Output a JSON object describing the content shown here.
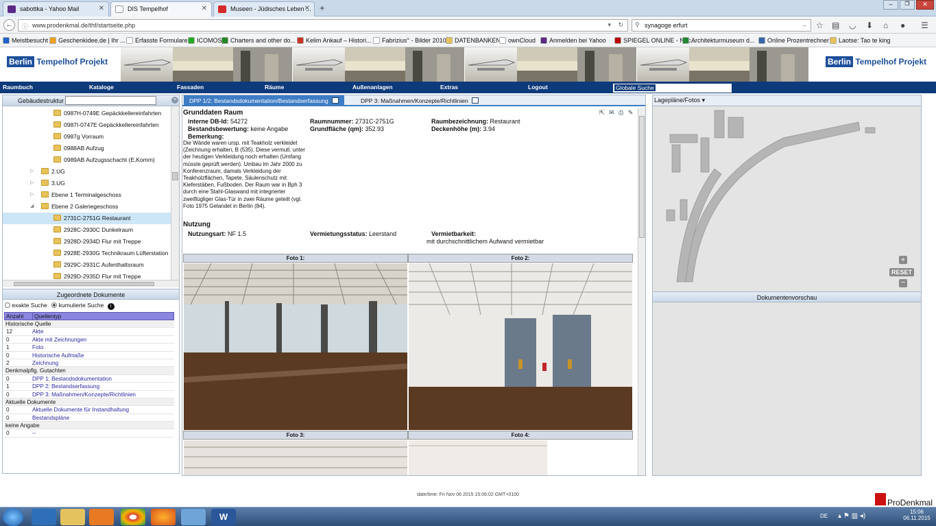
{
  "browser": {
    "tabs": [
      {
        "label": "sabottka - Yahoo Mail",
        "color": "#5b2a86"
      },
      {
        "label": "DIS Tempelhof",
        "color": "#ffffff"
      },
      {
        "label": "Museen - Jüdisches Leben ...",
        "color": "#d6292a"
      }
    ],
    "new_tab": "+",
    "url": "www.prodenkmal.de/thf/startseite.php",
    "search_value": "synagoge erfurt"
  },
  "bookmarks": [
    {
      "label": "Meistbesucht",
      "color": "#1d64c8"
    },
    {
      "label": "Geschenkidee.de | Ihr ...",
      "color": "#f0a21a"
    },
    {
      "label": "Erfasste Formulare",
      "color": "#ffffff"
    },
    {
      "label": "ICOMOS",
      "color": "#22aa22"
    },
    {
      "label": "Charters and other do...",
      "color": "#228822"
    },
    {
      "label": "Kelim Ankauf – Histori...",
      "color": "#cc3322"
    },
    {
      "label": "Fabrizius° - Bilder 2010",
      "color": "#ffffff"
    },
    {
      "label": "DATENBANKEN",
      "color": "#e8c25a"
    },
    {
      "label": "ownCloud",
      "color": "#ffffff"
    },
    {
      "label": "Anmelden bei Yahoo",
      "color": "#5b2a86"
    },
    {
      "label": "SPIEGEL ONLINE - Nac...",
      "color": "#b80000"
    },
    {
      "label": "Architekturmuseum d...",
      "color": "#228833"
    },
    {
      "label": "Online Prozentrechner",
      "color": "#3366aa"
    },
    {
      "label": "Laotse: Tao te king",
      "color": "#e8c25a"
    }
  ],
  "site": {
    "logo_text_a": "Berlin",
    "logo_text_b": "Tempelhof Projekt",
    "menu": [
      "Raumbuch",
      "Kataloge",
      "Fassaden",
      "Räume",
      "Außenanlagen",
      "Extras",
      "Logout"
    ],
    "global_search": "Globale Suche"
  },
  "left": {
    "structure_title": "Gebäudestruktur",
    "tree": [
      {
        "label": "0987H-0749E Gepäckkellereinfahrten",
        "level": 2,
        "expander": ""
      },
      {
        "label": "0987I-0747E Gepäckkellereinfahrten",
        "level": 2,
        "expander": ""
      },
      {
        "label": "0987g Vorraum",
        "level": 2,
        "expander": ""
      },
      {
        "label": "0988AB Aufzug",
        "level": 2,
        "expander": ""
      },
      {
        "label": "0989AB Aufzugsschacht (E,Komm)",
        "level": 2,
        "expander": ""
      },
      {
        "label": "2.UG",
        "level": 1,
        "expander": "▷"
      },
      {
        "label": "3.UG",
        "level": 1,
        "expander": "▷"
      },
      {
        "label": "Ebene 1 Terminalgeschoss",
        "level": 1,
        "expander": "▷"
      },
      {
        "label": "Ebene 2 Galeriegeschoss",
        "level": 1,
        "expander": "◢"
      },
      {
        "label": "2731C-2751G Restaurant",
        "level": 2,
        "expander": "",
        "selected": true
      },
      {
        "label": "2928C-2930C Dunkelraum",
        "level": 2,
        "expander": ""
      },
      {
        "label": "2928D-2934D Flur mit Treppe",
        "level": 2,
        "expander": ""
      },
      {
        "label": "2928E-2930G Technikraum Lüfterstation",
        "level": 2,
        "expander": ""
      },
      {
        "label": "2929C-2931C Aufenthaltsraum",
        "level": 2,
        "expander": ""
      },
      {
        "label": "2929D-2935D Flur mit Treppe",
        "level": 2,
        "expander": ""
      }
    ],
    "docs_title": "Zugeordnete Dokumente",
    "search_exact": "exakte Suche",
    "search_cumulative": "kumulierte Suche",
    "col_count": "Anzahl",
    "col_type": "Quellentyp",
    "groups": [
      {
        "name": "Historische Quelle",
        "rows": [
          {
            "n": "12",
            "label": "Akte"
          },
          {
            "n": "0",
            "label": "Akte mit Zeichnungen"
          },
          {
            "n": "1",
            "label": "Foto"
          },
          {
            "n": "0",
            "label": "Historische Aufmaße"
          },
          {
            "n": "2",
            "label": "Zeichnung"
          }
        ]
      },
      {
        "name": "Denkmalpflg. Gutachten",
        "rows": [
          {
            "n": "0",
            "label": "DPP 1: Bestandsdokumentation"
          },
          {
            "n": "1",
            "label": "DPP 2: Bestandserfassung"
          },
          {
            "n": "0",
            "label": "DPP 3: Maßnahmen/Konzepte/Richtlinien"
          }
        ]
      },
      {
        "name": "Aktuelle Dokumente",
        "rows": [
          {
            "n": "0",
            "label": "Aktuelle Dokumente für Instandhaltung"
          },
          {
            "n": "0",
            "label": "Bestandspläne"
          }
        ]
      },
      {
        "name": "keine Angabe",
        "rows": [
          {
            "n": "0",
            "label": "--"
          }
        ]
      }
    ]
  },
  "center": {
    "tab1": "DPP 1/2: Bestandsdokumentation/Bestandserfassung",
    "tab2": "DPP 3: Maßnahmen/Konzepte/Richtlinien",
    "section1": "Grunddaten Raum",
    "f_dbid_l": "interne DB-Id:",
    "f_dbid_v": "54272",
    "f_num_l": "Raumnummer:",
    "f_num_v": "2731C-2751G",
    "f_name_l": "Raumbezeichnung:",
    "f_name_v": "Restaurant",
    "f_eval_l": "Bestandsbewertung:",
    "f_eval_v": "keine Angabe",
    "f_area_l": "Grundfläche (qm):",
    "f_area_v": "352.93",
    "f_height_l": "Deckenhöhe (m):",
    "f_height_v": "3.94",
    "f_note_l": "Bemerkung:",
    "f_note_v": "Die Wände waren ursp. mit Teakholz verkleidet (Zeichnung erhalten, B (535). Diese vermutl. unter der heutigen Verkleidung noch erhalten (Umfang müsste geprüft werden). Umbau im Jahr 2000 zu Konferenzraum, damals Verkleidung der Teakholzflächen, Tapete. Säulenschutz mit Kieferstäben, Fußboden. Der Raum war in Bph 3 durch eine Stahl-Glaswand mit integrierter zweiflügliger Glas-Tür in zwei Räume geteilt (vgl. Foto 1975 Gelandet in Berlin (84).",
    "section2": "Nutzung",
    "f_use_l": "Nutzungsart:",
    "f_use_v": "NF 1.5",
    "f_rent_l": "Vermietungsstatus:",
    "f_rent_v": "Leerstand",
    "f_rentable_l": "Vermietbarkeit:",
    "f_rentable_v": "mit durchschnittlichem Aufwand vermietbar",
    "photos": [
      "Foto 1:",
      "Foto 2:",
      "Foto 3:",
      "Foto 4:"
    ]
  },
  "right": {
    "title": "Lagepläne/Fotos",
    "reset": "RESET",
    "docs_preview": "Dokumentenvorschau"
  },
  "footer": {
    "datetime": "date/time: Fri Nov 06 2015 15:06:02 GMT+0100",
    "brand": "ProDenkmal"
  },
  "taskbar": {
    "lang": "DE",
    "time": "15:06",
    "date": "06.11.2015"
  },
  "colors": {
    "menu_bg": "#0d3a7a",
    "tab_active": "#3e7cc4",
    "selected_row": "#cde6f7",
    "header_purple": "#8b86e0"
  }
}
